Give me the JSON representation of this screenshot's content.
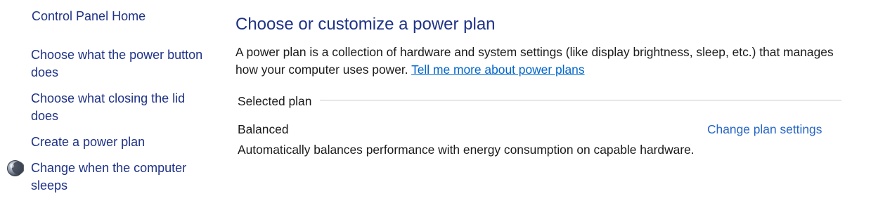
{
  "sidebar": {
    "home_label": "Control Panel Home",
    "links": [
      {
        "label": "Choose what the power button does"
      },
      {
        "label": "Choose what closing the lid does"
      },
      {
        "label": "Create a power plan"
      },
      {
        "label": "Change when the computer sleeps",
        "icon": "moon-icon"
      }
    ]
  },
  "main": {
    "title": "Choose or customize a power plan",
    "description": "A power plan is a collection of hardware and system settings (like display brightness, sleep, etc.) that manages how your computer uses power.",
    "help_link": "Tell me more about power plans",
    "selected_section_label": "Selected plan",
    "plan": {
      "name": "Balanced",
      "change_link": "Change plan settings",
      "description": "Automatically balances performance with energy consumption on capable hardware."
    }
  },
  "colors": {
    "link": "#1e3287",
    "hyperlink": "#0066cc",
    "text": "#1a1a1a",
    "rule": "#c8c8c8"
  }
}
